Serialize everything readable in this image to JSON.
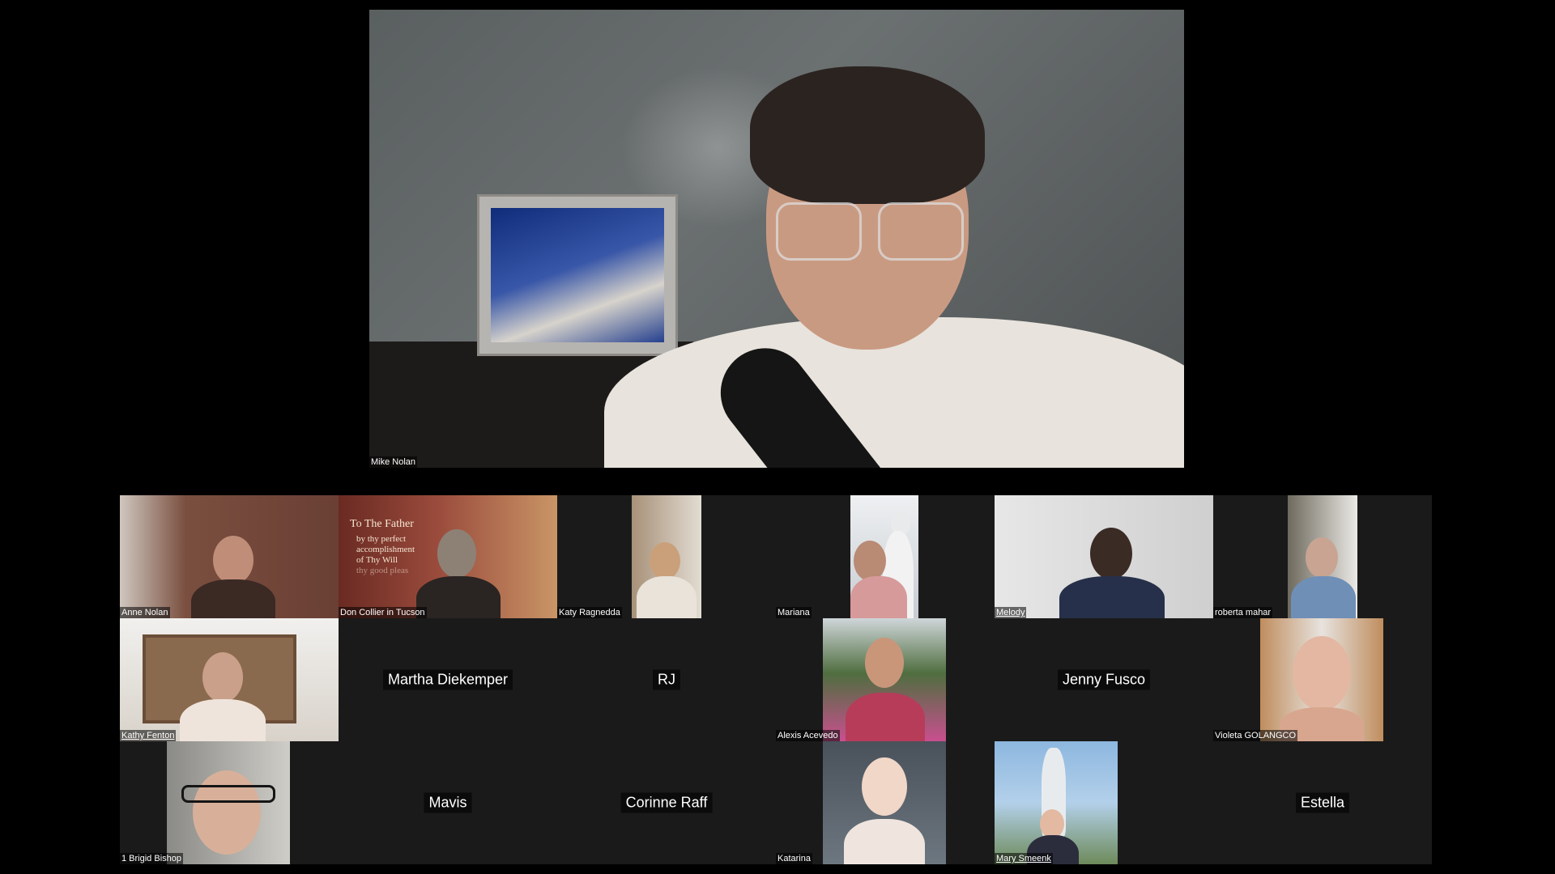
{
  "speaker": {
    "name": "Mike Nolan"
  },
  "participants": [
    {
      "name": "Anne Nolan",
      "video": true
    },
    {
      "name": "Don Collier in Tucson",
      "video": true,
      "background_text": [
        "To The Father",
        "by thy perfect",
        "accomplishment",
        "of Thy Will",
        "thy good pleas"
      ]
    },
    {
      "name": "Katy Ragnedda",
      "video": true
    },
    {
      "name": "Mariana",
      "video": true
    },
    {
      "name": "Melody",
      "video": true,
      "active": true
    },
    {
      "name": "roberta mahar",
      "video": true
    },
    {
      "name": "Kathy Fenton",
      "video": true,
      "active": true
    },
    {
      "name": "Martha Diekemper",
      "video": false
    },
    {
      "name": "RJ",
      "video": false
    },
    {
      "name": "Alexis Acevedo",
      "video": true
    },
    {
      "name": "Jenny Fusco",
      "video": false
    },
    {
      "name": "Violeta GOLANGCO",
      "video": true
    },
    {
      "name": "1 Brigid Bishop",
      "video": true
    },
    {
      "name": "Mavis",
      "video": false
    },
    {
      "name": "Corinne Raff",
      "video": false
    },
    {
      "name": "Katarina",
      "video": true
    },
    {
      "name": "Mary Smeenk",
      "video": true,
      "active": true
    },
    {
      "name": "Estella",
      "video": false
    }
  ]
}
